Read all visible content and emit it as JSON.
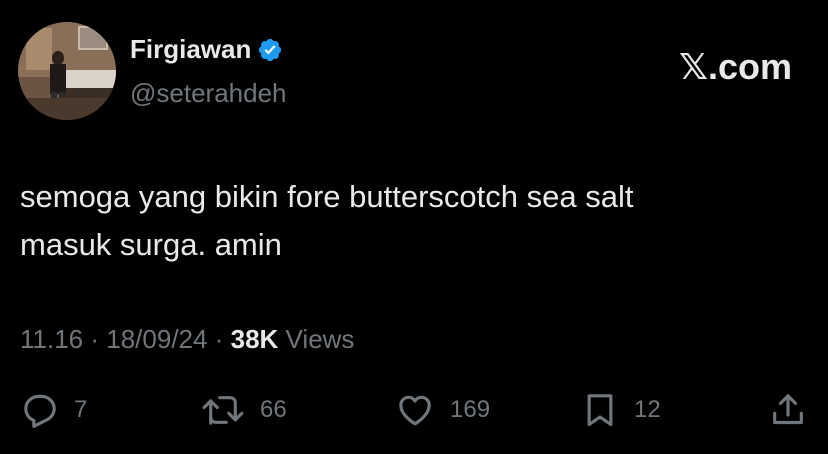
{
  "author": {
    "display_name": "Firgiawan",
    "handle": "@seterahdeh",
    "verified": true
  },
  "brand": "𝕏.com",
  "tweet": {
    "lines": [
      "semoga yang bikin fore butterscotch sea salt",
      "masuk surga. amin"
    ],
    "time": "11.16",
    "date": "18/09/24",
    "views_count": "38K",
    "views_label": "Views",
    "separator": "·"
  },
  "actions": {
    "replies": "7",
    "reposts": "66",
    "likes": "169",
    "bookmarks": "12"
  },
  "icons": {
    "reply": "reply-icon",
    "repost": "repost-icon",
    "like": "heart-icon",
    "bookmark": "bookmark-icon",
    "share": "share-icon",
    "verified": "verified-badge-icon"
  },
  "colors": {
    "background": "#000000",
    "primary_text": "#e7e9ea",
    "secondary_text": "#71767b",
    "verified_blue": "#1d9bf0"
  }
}
